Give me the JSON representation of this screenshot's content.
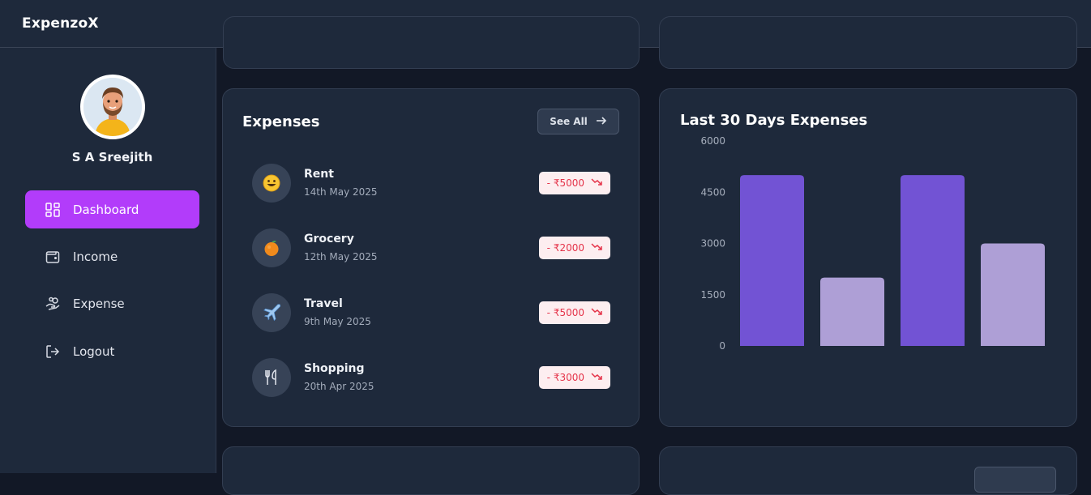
{
  "app": {
    "title": "ExpenzoX"
  },
  "user": {
    "name": "S A Sreejith"
  },
  "sidebar": {
    "items": [
      {
        "label": "Dashboard",
        "icon": "dashboard-icon",
        "active": true
      },
      {
        "label": "Income",
        "icon": "wallet-icon",
        "active": false
      },
      {
        "label": "Expense",
        "icon": "hand-coins-icon",
        "active": false
      },
      {
        "label": "Logout",
        "icon": "logout-icon",
        "active": false
      }
    ]
  },
  "expenses_card": {
    "title": "Expenses",
    "see_all_label": "See All",
    "items": [
      {
        "name": "Rent",
        "date": "14th May 2025",
        "amount": "- ₹5000",
        "icon": "smiley-emoji"
      },
      {
        "name": "Grocery",
        "date": "12th May 2025",
        "amount": "- ₹2000",
        "icon": "orange-emoji"
      },
      {
        "name": "Travel",
        "date": "9th May 2025",
        "amount": "- ₹5000",
        "icon": "airplane-emoji"
      },
      {
        "name": "Shopping",
        "date": "20th Apr 2025",
        "amount": "- ₹3000",
        "icon": "utensils-icon"
      }
    ]
  },
  "chart_card": {
    "title": "Last 30 Days Expenses"
  },
  "colors": {
    "accent": "#b23cfa",
    "bar_dark": "#7253d4",
    "bar_light": "#ae9fd6",
    "negative": "#e5344a"
  },
  "chart_data": {
    "type": "bar",
    "title": "Last 30 Days Expenses",
    "categories": [
      "",
      "",
      "",
      ""
    ],
    "values": [
      5000,
      2000,
      5000,
      3000
    ],
    "yticks": [
      "6000",
      "4500",
      "3000",
      "1500",
      "0"
    ],
    "ylim": [
      0,
      6000
    ],
    "xlabel": "",
    "ylabel": "",
    "grid": false,
    "legend": "none"
  }
}
